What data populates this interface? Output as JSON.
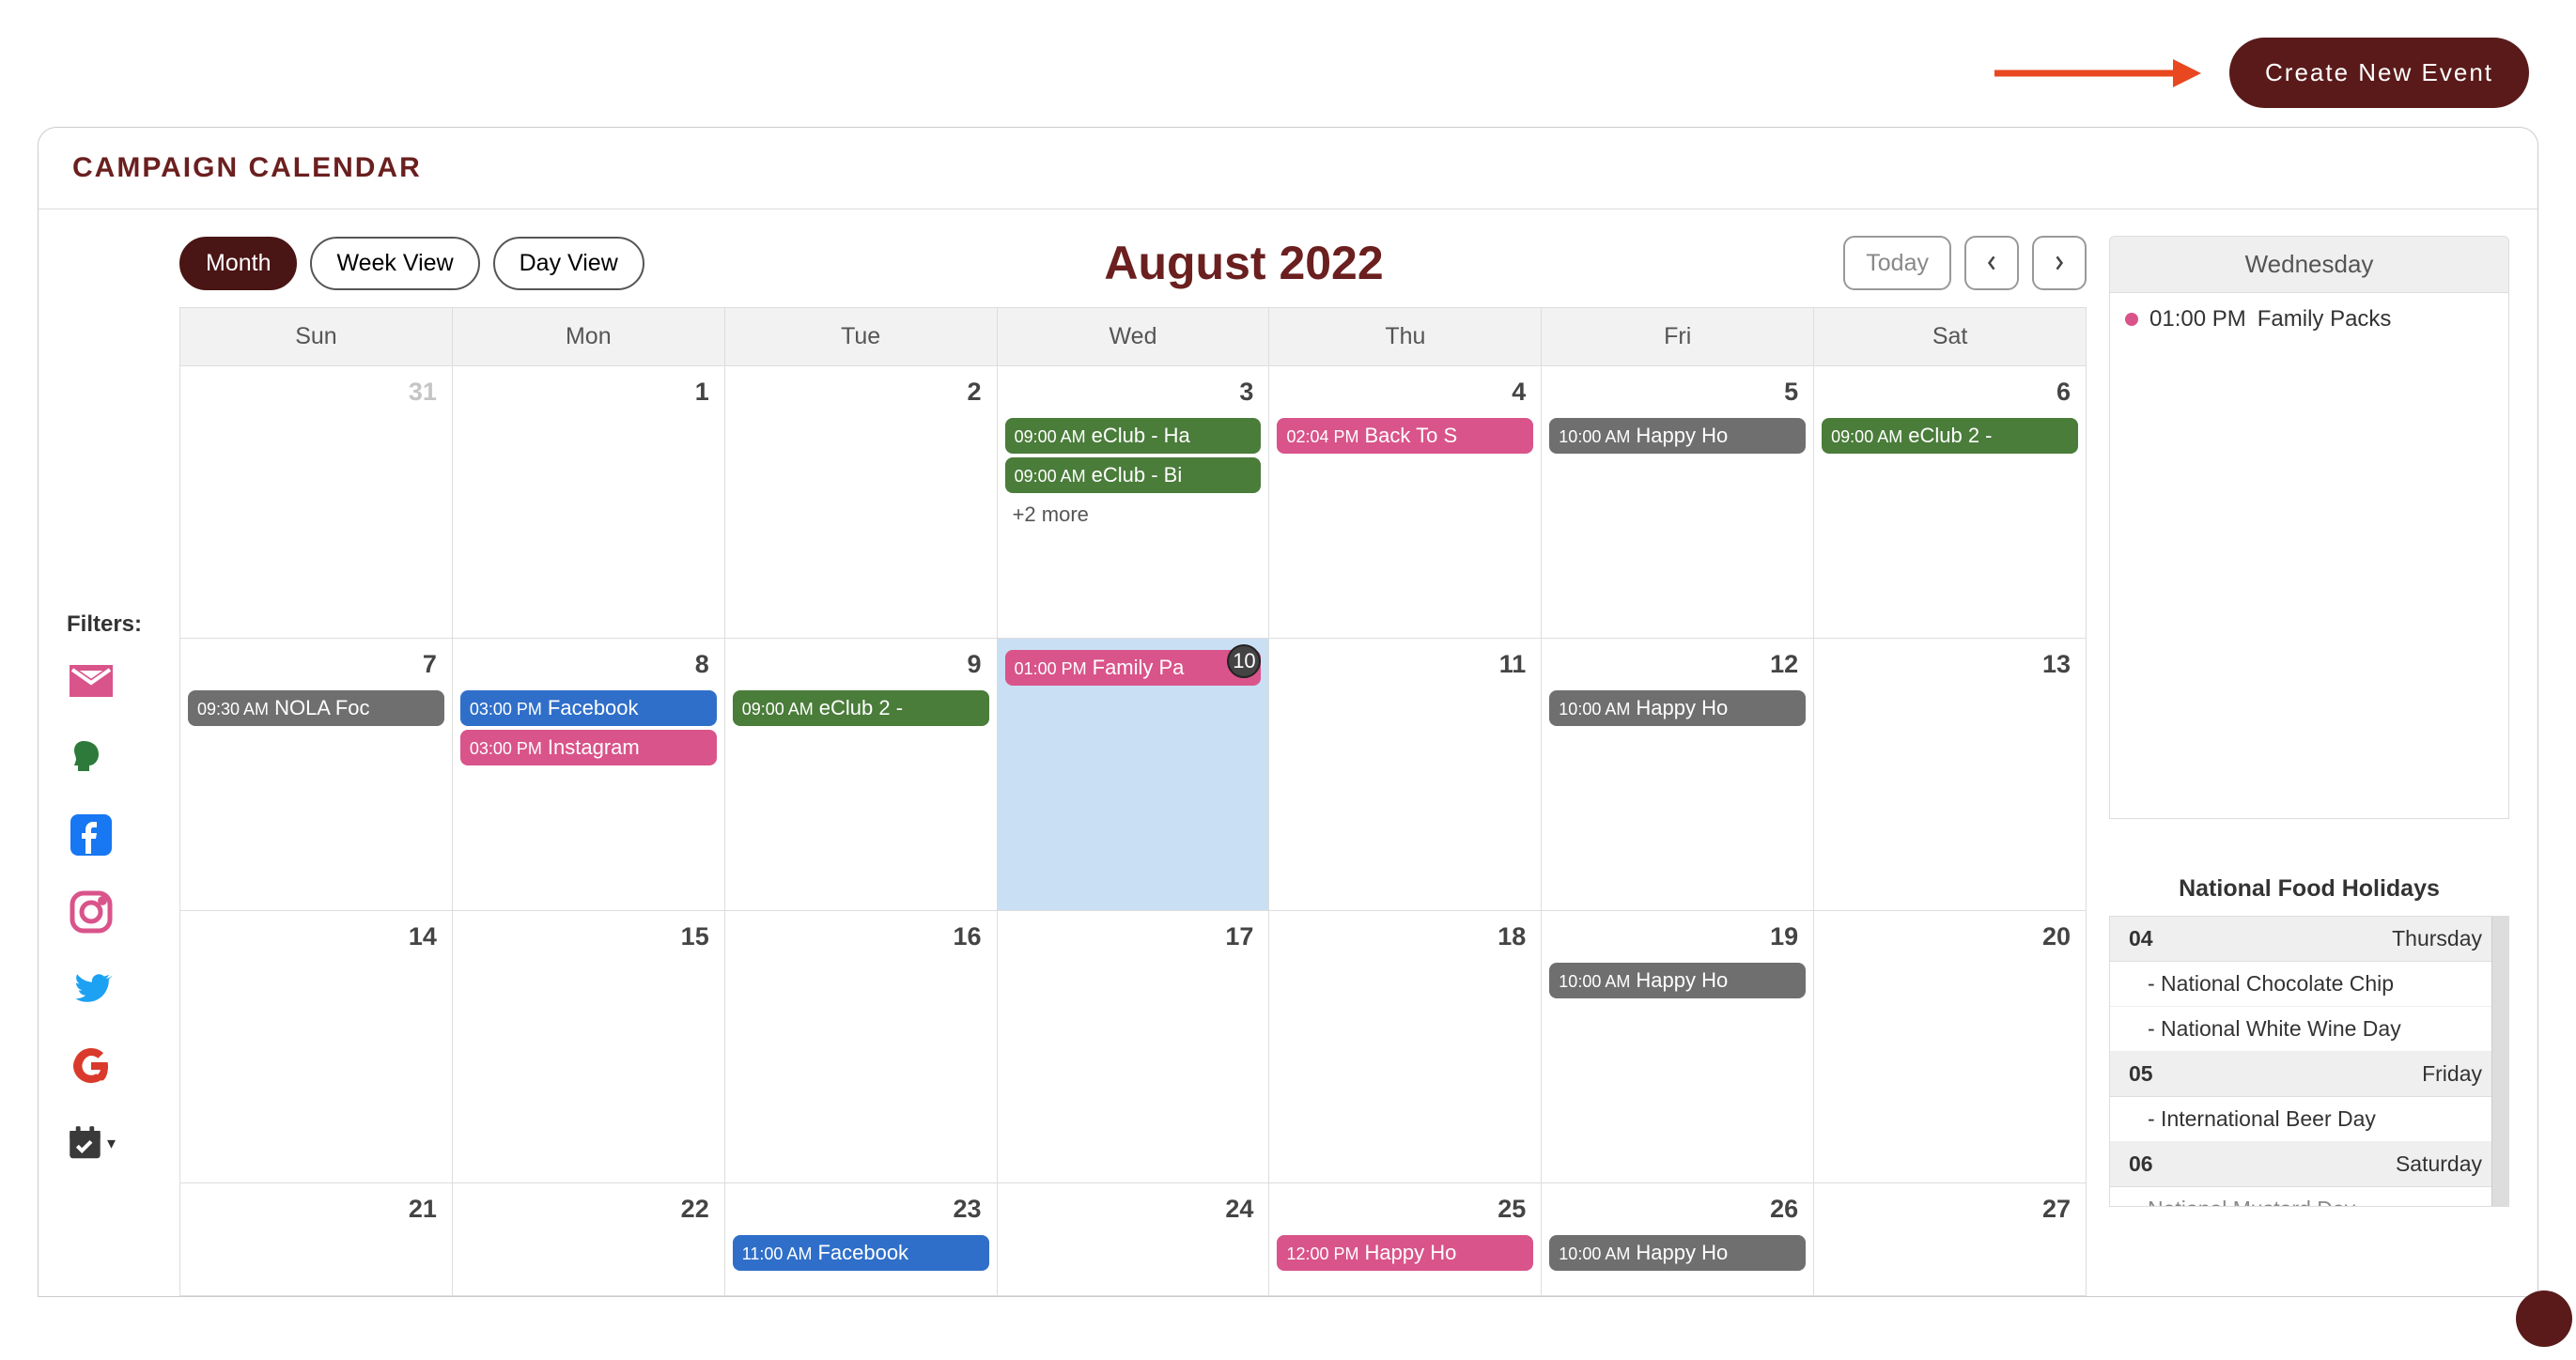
{
  "top": {
    "create_label": "Create New Event"
  },
  "panel": {
    "title": "CAMPAIGN CALENDAR"
  },
  "filters": {
    "label": "Filters:"
  },
  "calendar": {
    "views": {
      "month": "Month",
      "week": "Week View",
      "day": "Day View"
    },
    "title": "August 2022",
    "today_label": "Today",
    "day_headers": [
      "Sun",
      "Mon",
      "Tue",
      "Wed",
      "Thu",
      "Fri",
      "Sat"
    ],
    "weeks": [
      {
        "days": [
          {
            "num": "31",
            "muted": true,
            "events": []
          },
          {
            "num": "1",
            "events": []
          },
          {
            "num": "2",
            "events": []
          },
          {
            "num": "3",
            "events": [
              {
                "time": "09:00 AM",
                "title": "eClub - Ha",
                "color": "green"
              },
              {
                "time": "09:00 AM",
                "title": "eClub - Bi",
                "color": "green"
              }
            ],
            "more": "+2 more"
          },
          {
            "num": "4",
            "events": [
              {
                "time": "02:04 PM",
                "title": "Back To S",
                "color": "pink"
              }
            ]
          },
          {
            "num": "5",
            "events": [
              {
                "time": "10:00 AM",
                "title": "Happy Ho",
                "color": "gray"
              }
            ]
          },
          {
            "num": "6",
            "events": [
              {
                "time": "09:00 AM",
                "title": "eClub 2 - ",
                "color": "green"
              }
            ]
          }
        ]
      },
      {
        "days": [
          {
            "num": "7",
            "events": [
              {
                "time": "09:30 AM",
                "title": "NOLA Foc",
                "color": "gray"
              }
            ]
          },
          {
            "num": "8",
            "events": [
              {
                "time": "03:00 PM",
                "title": "Facebook",
                "color": "blue"
              },
              {
                "time": "03:00 PM",
                "title": "Instagram",
                "color": "pink"
              }
            ]
          },
          {
            "num": "9",
            "events": [
              {
                "time": "09:00 AM",
                "title": "eClub 2 - ",
                "color": "green"
              }
            ]
          },
          {
            "num": "10",
            "today": true,
            "events": [
              {
                "time": "01:00 PM",
                "title": "Family Pa",
                "color": "pink"
              }
            ]
          },
          {
            "num": "11",
            "events": []
          },
          {
            "num": "12",
            "events": [
              {
                "time": "10:00 AM",
                "title": "Happy Ho",
                "color": "gray"
              }
            ]
          },
          {
            "num": "13",
            "events": []
          }
        ]
      },
      {
        "days": [
          {
            "num": "14",
            "events": []
          },
          {
            "num": "15",
            "events": []
          },
          {
            "num": "16",
            "events": []
          },
          {
            "num": "17",
            "events": []
          },
          {
            "num": "18",
            "events": []
          },
          {
            "num": "19",
            "events": [
              {
                "time": "10:00 AM",
                "title": "Happy Ho",
                "color": "gray"
              }
            ]
          },
          {
            "num": "20",
            "events": []
          }
        ]
      },
      {
        "days": [
          {
            "num": "21",
            "events": []
          },
          {
            "num": "22",
            "events": []
          },
          {
            "num": "23",
            "events": [
              {
                "time": "11:00 AM",
                "title": "Facebook",
                "color": "blue"
              }
            ]
          },
          {
            "num": "24",
            "events": []
          },
          {
            "num": "25",
            "events": [
              {
                "time": "12:00 PM",
                "title": "Happy Ho",
                "color": "pink"
              }
            ]
          },
          {
            "num": "26",
            "events": [
              {
                "time": "10:00 AM",
                "title": "Happy Ho",
                "color": "gray"
              }
            ]
          },
          {
            "num": "27",
            "events": []
          }
        ]
      }
    ]
  },
  "side": {
    "day_label": "Wednesday",
    "events": [
      {
        "time": "01:00 PM",
        "title": "Family Packs"
      }
    ],
    "holidays_title": "National Food Holidays",
    "holidays": [
      {
        "date": "04",
        "dow": "Thursday",
        "items": [
          "- National Chocolate Chip",
          "- National White Wine Day"
        ]
      },
      {
        "date": "05",
        "dow": "Friday",
        "items": [
          "- International Beer Day"
        ]
      },
      {
        "date": "06",
        "dow": "Saturday",
        "items": [
          "National Mustard Day"
        ]
      }
    ]
  }
}
